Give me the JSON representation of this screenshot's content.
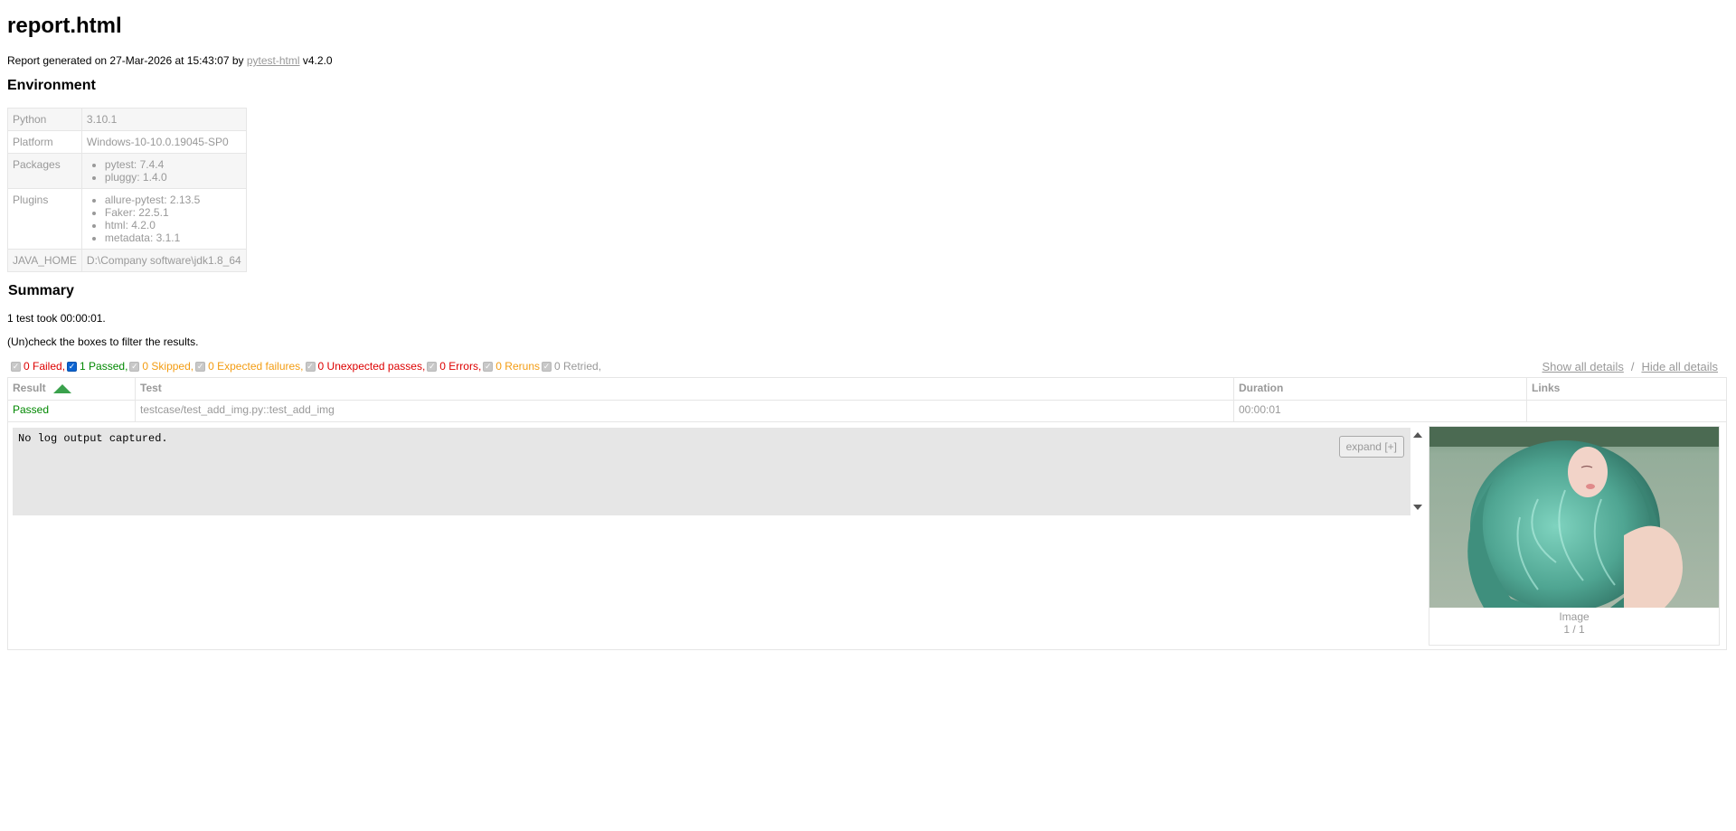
{
  "title": "report.html",
  "generated": {
    "prefix": "Report generated on 27-Mar-2026 at 15:43:07 by ",
    "link": "pytest-html",
    "suffix": " v4.2.0"
  },
  "environment": {
    "heading": "Environment",
    "python": {
      "key": "Python",
      "value": "3.10.1"
    },
    "platform": {
      "key": "Platform",
      "value": "Windows-10-10.0.19045-SP0"
    },
    "packages": {
      "key": "Packages",
      "items": [
        "pytest: 7.4.4",
        "pluggy: 1.4.0"
      ]
    },
    "plugins": {
      "key": "Plugins",
      "items": [
        "allure-pytest: 2.13.5",
        "Faker: 22.5.1",
        "html: 4.2.0",
        "metadata: 3.1.1"
      ]
    },
    "java_home": {
      "key": "JAVA_HOME",
      "value": "D:\\Company software\\jdk1.8_64"
    }
  },
  "summary": {
    "heading": "Summary",
    "took": "1 test took 00:00:01.",
    "hint": "(Un)check the boxes to filter the results."
  },
  "filters": {
    "failed": "0 Failed,",
    "passed": "1 Passed,",
    "skipped": "0 Skipped,",
    "xfailed": "0 Expected failures,",
    "xpassed": "0 Unexpected passes,",
    "errors": "0 Errors,",
    "reruns": "0 Reruns",
    "retried": "0 Retried,"
  },
  "details": {
    "show": "Show all details",
    "separator": "/",
    "hide": "Hide all details"
  },
  "table": {
    "headers": {
      "result": "Result",
      "test": "Test",
      "duration": "Duration",
      "links": "Links"
    },
    "row": {
      "result": "Passed",
      "test": "testcase/test_add_img.py::test_add_img",
      "duration": "00:00:01",
      "links": ""
    },
    "log": "No log output captured.",
    "expand": "expand [+]",
    "media": {
      "label": "Image",
      "count": "1 / 1"
    }
  },
  "colors": {
    "failed": "#dd0000",
    "passed": "#008800",
    "skipped": "#f39c12",
    "muted": "#999999",
    "sort_arrow": "#3aa14c"
  }
}
